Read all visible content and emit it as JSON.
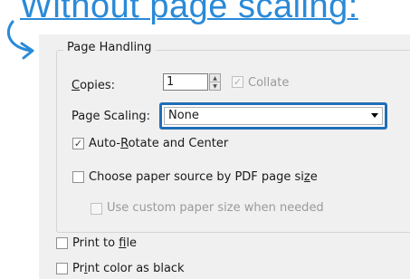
{
  "headline": "Without page scaling:",
  "page_handling": {
    "title": "Page Handling",
    "copies_label_u": "C",
    "copies_label_rest": "opies:",
    "copies_value": "1",
    "collate_label": "Collate",
    "collate_checked": true,
    "collate_disabled": true,
    "page_scaling_label": "Page Scaling:",
    "page_scaling_value": "None",
    "auto_rotate_pre": "Auto-",
    "auto_rotate_u": "R",
    "auto_rotate_post": "otate and Center",
    "auto_rotate_checked": true,
    "paper_source_pre": "Choose paper source by PDF page si",
    "paper_source_u": "z",
    "paper_source_post": "e",
    "paper_source_checked": false,
    "custom_paper_label": "Use custom paper size when needed",
    "custom_paper_checked": false
  },
  "print_to_file_pre": "Print to ",
  "print_to_file_u": "f",
  "print_to_file_post": "ile",
  "print_to_file_checked": false,
  "print_black_pre": "Pr",
  "print_black_u": "i",
  "print_black_post": "nt color as black",
  "print_black_checked": false,
  "colors": {
    "headline": "#2a8ad8",
    "highlight_border": "#1f6fb6",
    "panel_bg": "#f0f0f0"
  }
}
